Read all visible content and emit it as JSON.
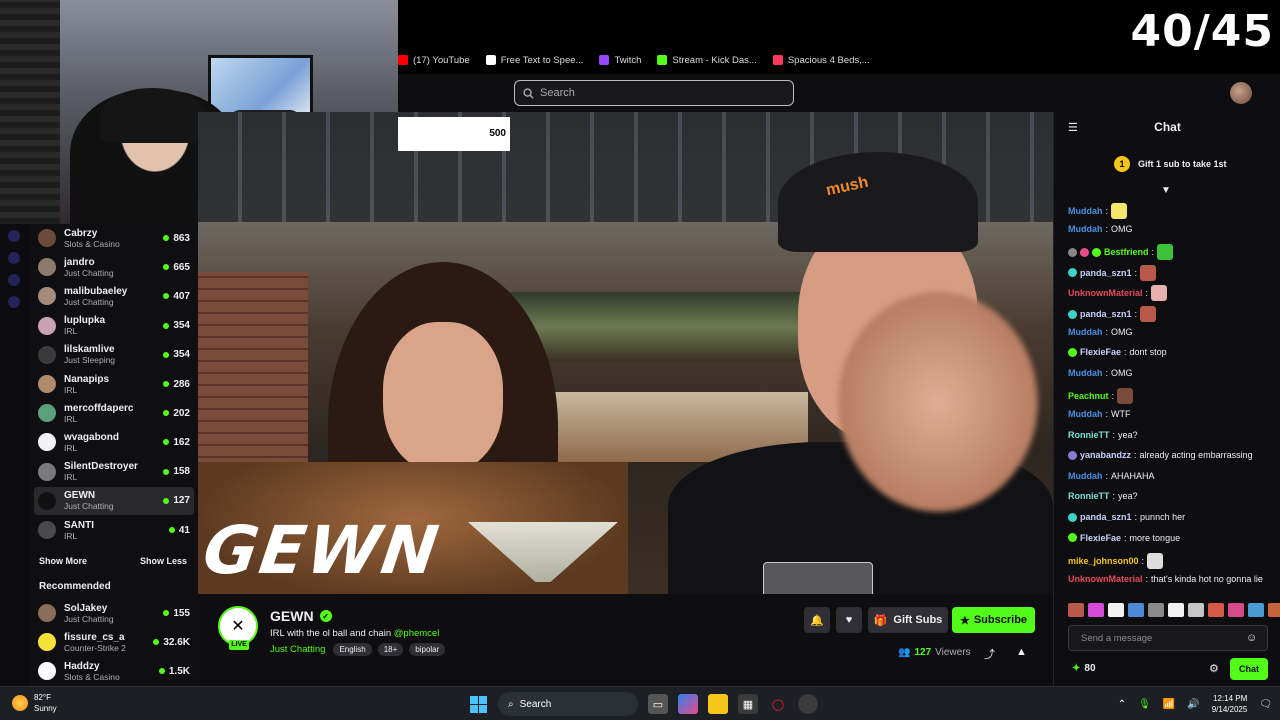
{
  "overlay": {
    "counter": "40/45",
    "goal_value": "500",
    "watermark": "GEWN"
  },
  "bookmarks": [
    {
      "label": "(17) YouTube",
      "color": "#ff0000"
    },
    {
      "label": "Free Text to Spee...",
      "color": "#ffffff"
    },
    {
      "label": "Twitch",
      "color": "#9146ff"
    },
    {
      "label": "Stream - Kick Das...",
      "color": "#53fc18"
    },
    {
      "label": "Spacious 4 Beds,...",
      "color": "#ff385c"
    }
  ],
  "header": {
    "search_placeholder": "Search"
  },
  "sidebar": {
    "following": [
      {
        "name": "Cabrzy",
        "category": "Slots & Casino",
        "viewers": "863",
        "color": "#6b4a3b"
      },
      {
        "name": "jandro",
        "category": "Just Chatting",
        "viewers": "665",
        "color": "#8c7a6a"
      },
      {
        "name": "malibubaeley",
        "category": "Just Chatting",
        "viewers": "407",
        "color": "#a58c7a"
      },
      {
        "name": "luplupka",
        "category": "IRL",
        "viewers": "354",
        "color": "#c9a3b0"
      },
      {
        "name": "lilskamlive",
        "category": "Just Sleeping",
        "viewers": "354",
        "color": "#3a3a3a"
      },
      {
        "name": "Nanapips",
        "category": "IRL",
        "viewers": "286",
        "color": "#b08a6c"
      },
      {
        "name": "mercoffdaperc",
        "category": "IRL",
        "viewers": "202",
        "color": "#5aa07a"
      },
      {
        "name": "wvagabond",
        "category": "IRL",
        "viewers": "162",
        "color": "#f2f2f2"
      },
      {
        "name": "SilentDestroyer",
        "category": "IRL",
        "viewers": "158",
        "color": "#7a7a7a"
      },
      {
        "name": "GEWN",
        "category": "Just Chatting",
        "viewers": "127",
        "color": "#111111"
      },
      {
        "name": "SANTI",
        "category": "IRL",
        "viewers": "41",
        "color": "#4a4a4a"
      }
    ],
    "show_more": "Show More",
    "show_less": "Show Less",
    "recommended_title": "Recommended",
    "recommended": [
      {
        "name": "SolJakey",
        "category": "Just Chatting",
        "viewers": "155",
        "color": "#8a6c5a"
      },
      {
        "name": "fissure_cs_a",
        "category": "Counter-Strike 2",
        "viewers": "32.6K",
        "color": "#f5e23a"
      },
      {
        "name": "Haddzy",
        "category": "Slots & Casino",
        "viewers": "1.5K",
        "color": "#ffffff"
      }
    ]
  },
  "channel": {
    "name": "GEWN",
    "live": "LIVE",
    "title": "IRL with the ol ball and chain",
    "mention": "@phemcel",
    "category": "Just Chatting",
    "tags": [
      "English",
      "18+",
      "bipolar"
    ],
    "gift_label": "Gift Subs",
    "subscribe_label": "Subscribe",
    "viewers": "127",
    "viewers_label": "Viewers"
  },
  "chat": {
    "title": "Chat",
    "pinned": "Gift 1 sub to take 1st",
    "pinned_rank": "1",
    "messages": [
      {
        "user": "Muddah",
        "text": "",
        "color": "#4a90e2",
        "emote": "#f2e76a"
      },
      {
        "user": "Muddah",
        "text": "OMG",
        "color": "#4a90e2"
      },
      {
        "user": "Bestfriend",
        "text": "",
        "color": "#53fc18",
        "emote": "#3cc13b",
        "badges": [
          "#888",
          "#e84a8a",
          "#53fc18"
        ]
      },
      {
        "user": "panda_szn1",
        "text": "",
        "color": "#c6d2ff",
        "emote": "#b85a4a",
        "badges": [
          "#3fd2c7"
        ]
      },
      {
        "user": "UnknownMaterial",
        "text": "",
        "color": "#e84a5f",
        "emote": "#e8b0b0"
      },
      {
        "user": "panda_szn1",
        "text": "",
        "color": "#c6d2ff",
        "emote": "#b85a4a",
        "badges": [
          "#3fd2c7"
        ]
      },
      {
        "user": "Muddah",
        "text": "OMG",
        "color": "#4a90e2"
      },
      {
        "user": "FlexieFae",
        "text": "dont stop",
        "color": "#c6d2ff",
        "badges": [
          "#53fc18"
        ]
      },
      {
        "user": "Muddah",
        "text": "OMG",
        "color": "#4a90e2"
      },
      {
        "user": "Peachnut",
        "text": "",
        "color": "#53fc18",
        "emote": "#7a4a3a"
      },
      {
        "user": "Muddah",
        "text": "WTF",
        "color": "#4a90e2"
      },
      {
        "user": "RonnieTT",
        "text": "yea?",
        "color": "#7be0d6"
      },
      {
        "user": "yanabandzz",
        "text": "already acting embarrassing",
        "color": "#c6d2ff",
        "badges": [
          "#8a7cd6"
        ]
      },
      {
        "user": "Muddah",
        "text": "AHAHAHA",
        "color": "#4a90e2"
      },
      {
        "user": "RonnieTT",
        "text": "yea?",
        "color": "#7be0d6"
      },
      {
        "user": "panda_szn1",
        "text": "punnch her",
        "color": "#c6d2ff",
        "badges": [
          "#3fd2c7"
        ]
      },
      {
        "user": "FlexieFae",
        "text": "more tongue",
        "color": "#c6d2ff",
        "badges": [
          "#53fc18"
        ]
      },
      {
        "user": "mike_johnson00",
        "text": "",
        "color": "#f5c518",
        "emote": "#dddddd"
      },
      {
        "user": "UnknownMaterial",
        "text": "that's kinda hot no gonna lie",
        "color": "#e84a5f"
      }
    ],
    "emote_colors": [
      "#b85a4a",
      "#d64ad6",
      "#f2f2f2",
      "#4a8ad6",
      "#8a8a8a",
      "#f2f2f2",
      "#c6c6c6",
      "#d65a4a",
      "#d64a8a",
      "#4a9ad6",
      "#c6643a",
      "#7a4a3a",
      "#53fc18"
    ],
    "input_placeholder": "Send a message",
    "points": "80",
    "send_label": "Chat"
  },
  "taskbar": {
    "temperature": "82°F",
    "weather": "Sunny",
    "search_label": "Search",
    "time": "12:14 PM",
    "date": "9/14/2025"
  }
}
